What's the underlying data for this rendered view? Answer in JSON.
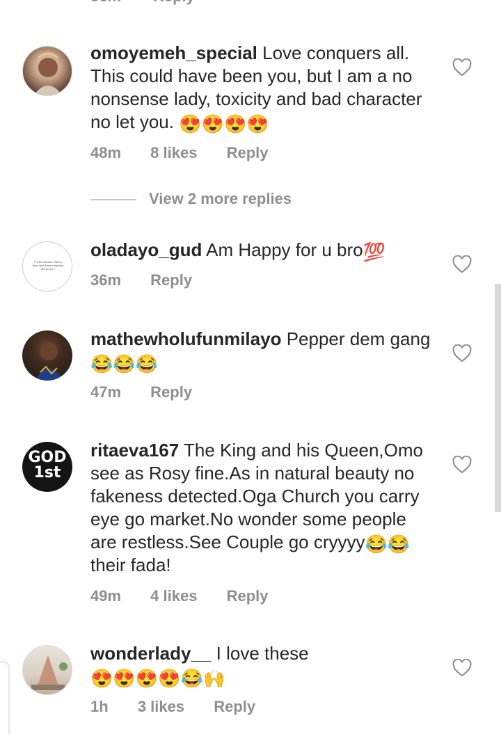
{
  "comments": [
    {
      "username": "omoyemeh_special",
      "text": "Love conquers all. This could have been you, but I am a no nonsense lady, toxicity and bad character no let you.",
      "emoji": "😍😍😍😍",
      "time": "48m",
      "likes": "8 likes",
      "reply": "Reply"
    },
    {
      "username": "oladayo_gud",
      "text": "Am Happy for u bro",
      "emoji": "💯",
      "time": "36m",
      "likes": "",
      "reply": "Reply",
      "avatar_text": "\"I cried, because I had no shoes until I met a man who had no feet.\""
    },
    {
      "username": "mathewholufunmilayo",
      "text": "Pepper dem gang",
      "emoji": "😂😂😂",
      "time": "47m",
      "likes": "",
      "reply": "Reply"
    },
    {
      "username": "ritaeva167",
      "text": "The King and his Queen,Omo see as Rosy fine.As in natural beauty no fakeness detected.Oga Church you carry eye go market.No wonder some people are restless.See Couple go cryyyy",
      "emoji": "😂😂",
      "text_after": "their fada!",
      "time": "49m",
      "likes": "4 likes",
      "reply": "Reply",
      "avatar_text": "GOD 1st"
    },
    {
      "username": "wonderlady__",
      "text": "I love these",
      "emoji": "😍😍😍😍😂🙌",
      "time": "1h",
      "likes": "3 likes",
      "reply": "Reply"
    }
  ],
  "view_more_replies": "View 2 more replies",
  "icons": {
    "like": "heart-outline-icon"
  },
  "colors": {
    "meta": "#8e8e8e",
    "text": "#262626"
  }
}
